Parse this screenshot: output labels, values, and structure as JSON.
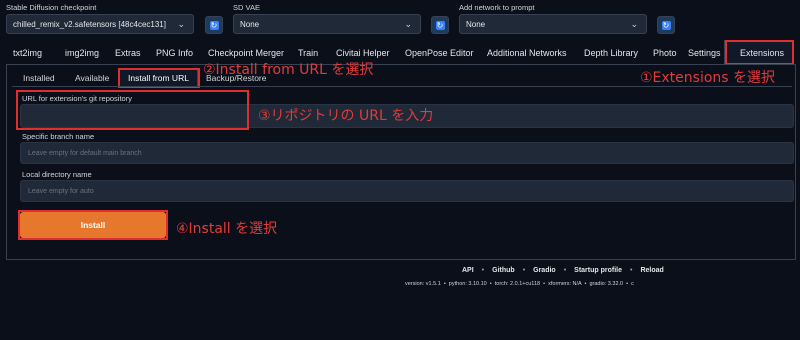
{
  "top": {
    "checkpoint": {
      "label": "Stable Diffusion checkpoint",
      "value": "chilled_remix_v2.safetensors [48c4cec131]"
    },
    "vae": {
      "label": "SD VAE",
      "value": "None"
    },
    "network": {
      "label": "Add network to prompt",
      "value": "None"
    }
  },
  "tabs": [
    "txt2img",
    "img2img",
    "Extras",
    "PNG Info",
    "Checkpoint Merger",
    "Train",
    "Civitai Helper",
    "OpenPose Editor",
    "Additional Networks",
    "Depth Library",
    "Photo",
    "Settings",
    "Extensions"
  ],
  "subtabs": [
    "Installed",
    "Available",
    "Install from URL",
    "Backup/Restore"
  ],
  "form": {
    "url_label": "URL for extension's git repository",
    "url_value": "",
    "branch_label": "Specific branch name",
    "branch_placeholder": "Leave empty for default main branch",
    "dir_label": "Local directory name",
    "dir_placeholder": "Leave empty for auto",
    "install_label": "Install"
  },
  "annotations": {
    "a1": "①Extensions を選択",
    "a2": "②Install from URL を選択",
    "a3": "③リポジトリの URL を入力",
    "a4": "④Install を選択"
  },
  "footer": {
    "links": [
      "API",
      "Github",
      "Gradio",
      "Startup profile",
      "Reload"
    ],
    "versions": "version: v1.5.1  •  python: 3.10.10  •  torch: 2.0.1+cu118  •  xformers: N/A  •  gradio: 3.32.0  •  c"
  },
  "colors": {
    "accent": "#e8772e",
    "annotation": "#e02d2d",
    "background": "#0b0f19"
  }
}
